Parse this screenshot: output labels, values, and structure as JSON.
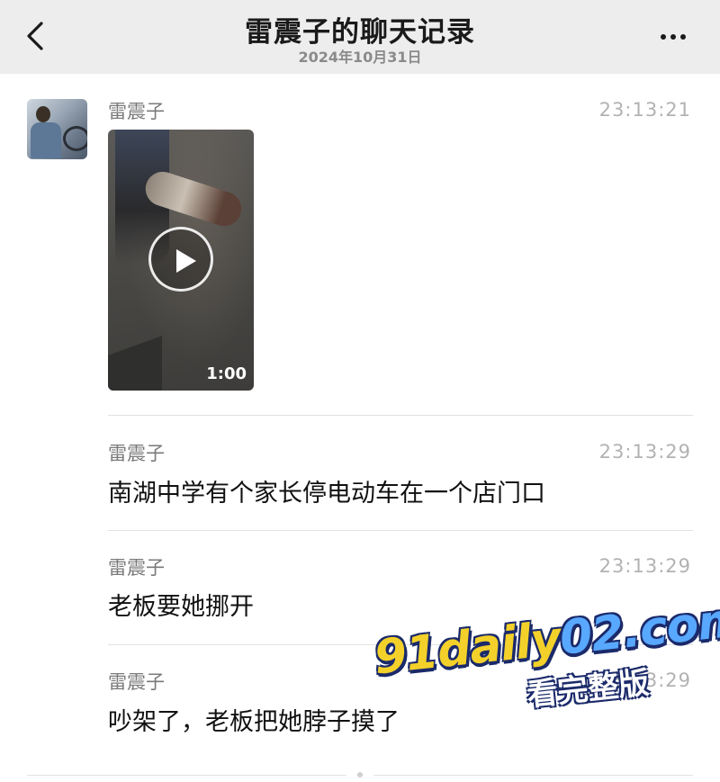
{
  "header": {
    "title": "雷震子的聊天记录",
    "date": "2024年10月31日",
    "back_icon": "chevron-left-icon",
    "more_icon": "more-dots-icon"
  },
  "messages": [
    {
      "sender": "雷震子",
      "time": "23:13:21",
      "type": "video",
      "duration": "1:00"
    },
    {
      "sender": "雷震子",
      "time": "23:13:29",
      "type": "text",
      "text": "南湖中学有个家长停电动车在一个店门口"
    },
    {
      "sender": "雷震子",
      "time": "23:13:29",
      "type": "text",
      "text": "老板要她挪开"
    },
    {
      "sender": "雷震子",
      "time": "23:13:29",
      "type": "text",
      "text": "吵架了，老板把她脖子摸了"
    }
  ],
  "watermark": {
    "domain_part1": "91daily",
    "domain_part2": "02.com",
    "tagline": "看完整版"
  }
}
